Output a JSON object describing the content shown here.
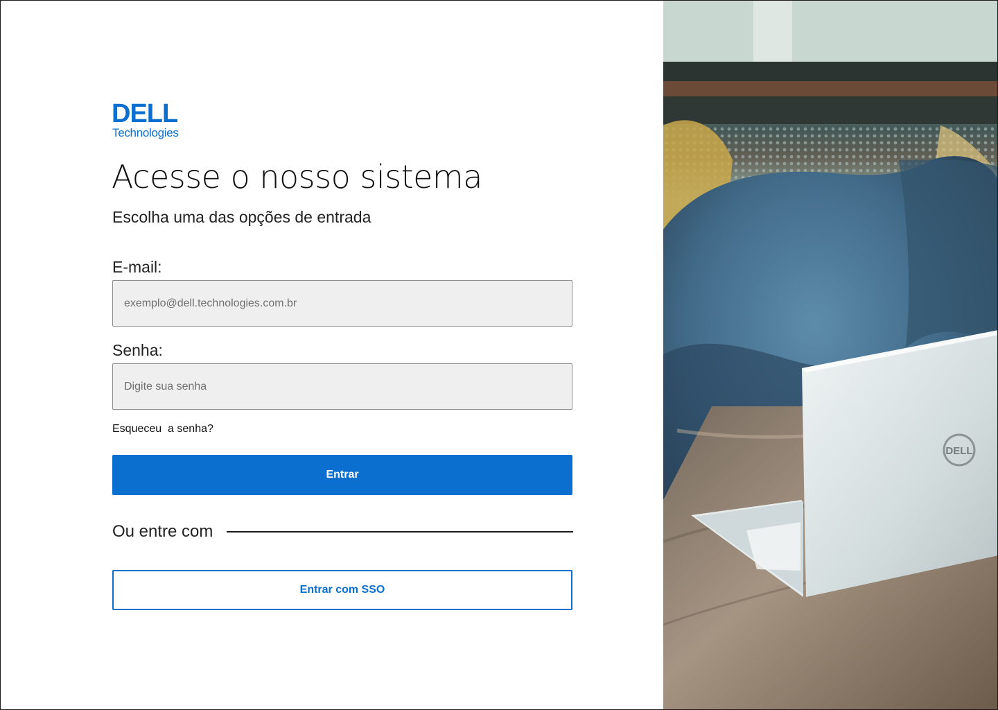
{
  "brand": {
    "logo_mark": "DELL",
    "logo_sub": "Technologies",
    "color": "#0b6fd0"
  },
  "login": {
    "title": "Acesse o nosso sistema",
    "subtitle": "Escolha uma das opções de entrada",
    "email_label": "E-mail:",
    "email_placeholder": "exemplo@dell.technologies.com.br",
    "email_value": "",
    "password_label": "Senha:",
    "password_placeholder": "Digite sua senha",
    "password_value": "",
    "forgot_password": "Esqueceu  a senha?",
    "submit_label": "Entrar",
    "alt_prompt": "Ou entre com",
    "sso_label": "Entrar com SSO"
  },
  "photo": {
    "laptop_logo": "DELL",
    "description_icon": "laptop-photo",
    "colors": {
      "cushion": "#3c607d",
      "table": "#8b7a69",
      "laptop": "#dce3e4",
      "background": "#a7c4bf"
    }
  }
}
